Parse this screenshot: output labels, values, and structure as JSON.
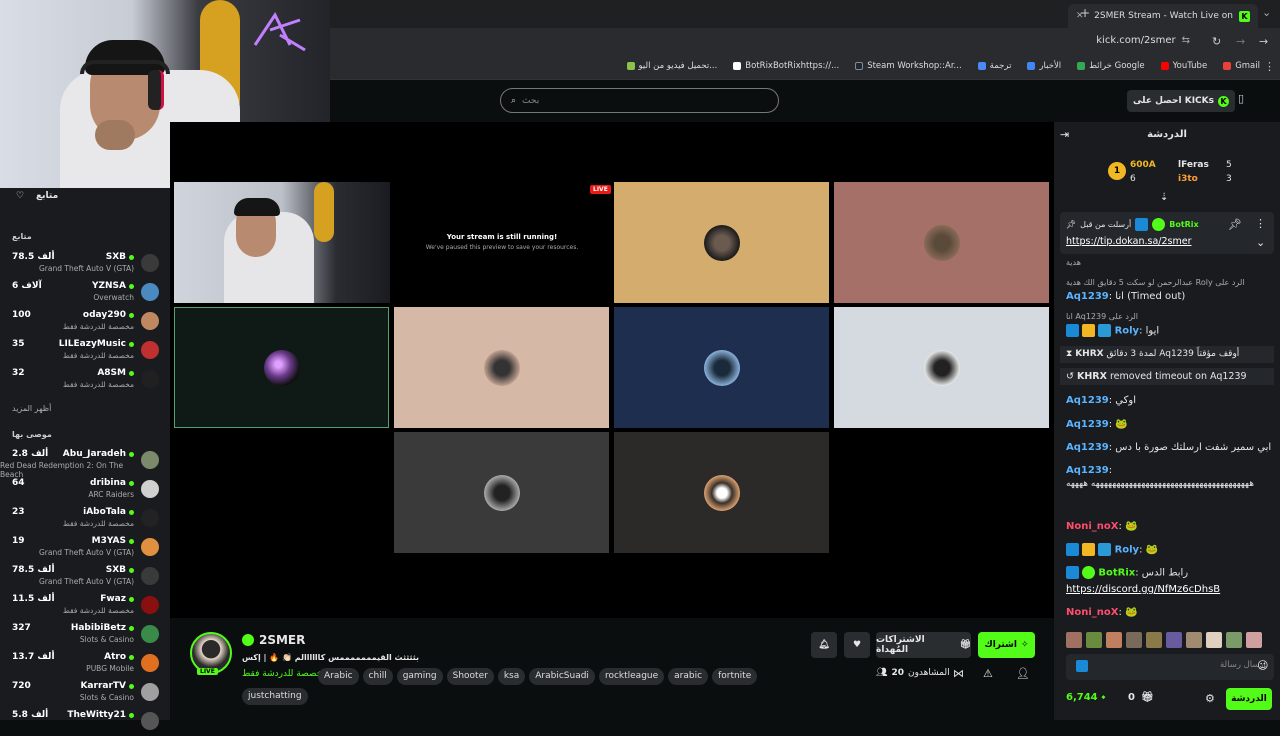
{
  "browser": {
    "tab_title": "2SMER Stream - Watch Live on",
    "url": "kick.com/2smer",
    "bookmarks": [
      "Gmail",
      "YouTube",
      "خرائط Google",
      "الأخبار",
      "ترجمة",
      "Steam Workshop::Ar...",
      "BotRixBotRixhttps://...",
      "تحميل فيديو من اليو..."
    ]
  },
  "nav": {
    "search_placeholder": "بحث",
    "get_kicks": "احصل على KICKs"
  },
  "sidebar": {
    "following_title": "متابع",
    "following_sub": "متابع",
    "show_more": "أظهر المزيد",
    "recommended_title": "موصى بها",
    "following": [
      {
        "name": "SXB",
        "viewers": "78.5 ألف",
        "game": "Grand Theft Auto V (GTA)",
        "color": "#3a3a3a"
      },
      {
        "name": "YZNSA",
        "viewers": "6 آلاف",
        "game": "Overwatch",
        "color": "#4a8ac0"
      },
      {
        "name": "oday290",
        "viewers": "100",
        "game": "مخصصة للدردشة فقط",
        "color": "#c08860"
      },
      {
        "name": "LILEazyMusic",
        "viewers": "35",
        "game": "مخصصة للدردشة فقط",
        "color": "#c03030"
      },
      {
        "name": "A8SM",
        "viewers": "32",
        "game": "مخصصة للدردشة فقط",
        "color": "#202020"
      }
    ],
    "recommended": [
      {
        "name": "Abu_Jaradeh",
        "viewers": "2.8 ألف",
        "game": "Red Dead Redemption 2: On The Beach",
        "color": "#7a8a6a"
      },
      {
        "name": "dribina",
        "viewers": "64",
        "game": "ARC Raiders",
        "color": "#d0d0d0"
      },
      {
        "name": "iAboTala",
        "viewers": "23",
        "game": "مخصصة للدردشة فقط",
        "color": "#222"
      },
      {
        "name": "M3YAS",
        "viewers": "19",
        "game": "Grand Theft Auto V (GTA)",
        "color": "#e09040"
      },
      {
        "name": "SXB",
        "viewers": "78.5 ألف",
        "game": "Grand Theft Auto V (GTA)",
        "color": "#3a3a3a"
      },
      {
        "name": "Fwaz",
        "viewers": "11.5 ألف",
        "game": "مخصصة للدردشة فقط",
        "color": "#8a1010"
      },
      {
        "name": "HabibiBetz",
        "viewers": "327",
        "game": "Slots & Casino",
        "color": "#3a8a4a"
      },
      {
        "name": "Atro",
        "viewers": "13.7 ألف",
        "game": "PUBG Mobile",
        "color": "#e07020"
      },
      {
        "name": "KarrarTV",
        "viewers": "720",
        "game": "Slots & Casino",
        "color": "#a0a0a0"
      },
      {
        "name": "TheWitty21",
        "viewers": "5.8 ألف",
        "game": "",
        "color": "#555"
      }
    ]
  },
  "stream": {
    "live_badge": "LIVE",
    "paused_title": "Your stream is still running!",
    "paused_sub": "We've paused this preview to save your resources.",
    "streamer": "2SMER",
    "title": "بثثثثث القيمممممممس كاااااالم 👏🏻 🔥 | إكس",
    "category": "مخصصة للدردشة فقط",
    "tags": [
      "Arabic",
      "chill",
      "gaming",
      "Shooter",
      "ksa",
      "ArabicSuadi",
      "rocktleague",
      "arabic",
      "fortnite",
      "justchatting"
    ],
    "viewers_label": "المشاهدون",
    "viewers": "20",
    "subscribe": "اشتراك",
    "gift_subs": "الاشتراكات المُهداة"
  },
  "chat": {
    "title": "الدردشة",
    "leaderboard": [
      {
        "name": "lFeras",
        "points": "5",
        "rank": "600A",
        "rank2": "6"
      },
      {
        "name": "i3to",
        "points": "3"
      }
    ],
    "pinned": {
      "user": "BotRix",
      "by": "أرسلت من قبل",
      "link": "https://tip.dokan.sa/2smer"
    },
    "messages": [
      {
        "user": "",
        "text": "هدية"
      },
      {
        "user": "",
        "text": "عبدالرحمن لو سكت 5 دقايق الك هدية Roly الرد على"
      },
      {
        "user": "Aq1239",
        "text": "انا (Timed out)"
      },
      {
        "user": "",
        "text": "انا Aq1239 الرد على"
      },
      {
        "user": "Roly",
        "text": "ايوا"
      },
      {
        "user": "KHRX",
        "text": "لمدة 3 دقائق Aq1239 أوقف مؤقتاً"
      },
      {
        "user": "KHRX",
        "text": "removed timeout on Aq1239"
      },
      {
        "user": "Aq1239",
        "text": "اوكي"
      },
      {
        "user": "Aq1239",
        "text": "🐸"
      },
      {
        "user": "Aq1239",
        "text": "ابي سمير شفت ارسلتك صورة با دس"
      },
      {
        "user": "Aq1239",
        "text": "ههههههههههههههههههههههههههههههههههههههه ههههه"
      },
      {
        "user": "Noni_noX",
        "text": "🐸"
      },
      {
        "user": "Roly",
        "text": "🐸"
      },
      {
        "user": "BotRix",
        "text": "رابط الدس"
      },
      {
        "user": "",
        "text": "https://discord.gg/NfMz6cDhsB"
      },
      {
        "user": "Noni_noX",
        "text": "🐸"
      }
    ],
    "input_placeholder": "إرسال رسالة",
    "points": "6,744",
    "bottom_count": "0",
    "chat_button": "الدردشة"
  },
  "colors": {
    "kick_green": "#53fc18",
    "chat_blue": "#5ab4ff",
    "noni_red": "#ff4d6d"
  }
}
